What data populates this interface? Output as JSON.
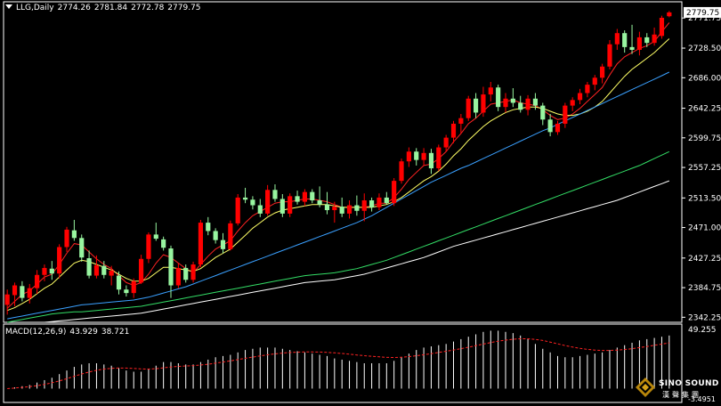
{
  "header": {
    "symbol": "LLG,Daily",
    "open": "2774.26",
    "high": "2781.84",
    "low": "2772.78",
    "close": "2779.75"
  },
  "macd": {
    "label": "MACD(12,26,9)",
    "main": "43.929",
    "signal": "38.721"
  },
  "logo": {
    "brand": "SINO SOUND",
    "sub": "漢聲集團"
  },
  "colors": {
    "up": "#ff0000",
    "down": "#98f5a0",
    "ma_fast": "#ff2222",
    "ma_mid": "#ffff66",
    "ma_slow1": "#3aa0ff",
    "ma_slow2": "#33dd66",
    "ma_slow3": "#ffffff",
    "grid": "#ffffff",
    "macd_hist": "#ffffff",
    "macd_signal": "#ff2222"
  },
  "chart_data": {
    "type": "candlestick",
    "title": "LLG,Daily",
    "ylim": [
      2335,
      2795
    ],
    "y_ticks": [
      "2771.75",
      "2728.50",
      "2686.00",
      "2642.25",
      "2599.75",
      "2557.25",
      "2513.50",
      "2471.00",
      "2427.25",
      "2384.75",
      "2342.25"
    ],
    "last_price_label": "2779.75",
    "candles": [
      {
        "o": 2360,
        "h": 2382,
        "l": 2346,
        "c": 2375
      },
      {
        "o": 2374,
        "h": 2392,
        "l": 2358,
        "c": 2388
      },
      {
        "o": 2387,
        "h": 2394,
        "l": 2365,
        "c": 2370
      },
      {
        "o": 2370,
        "h": 2390,
        "l": 2362,
        "c": 2384
      },
      {
        "o": 2384,
        "h": 2410,
        "l": 2376,
        "c": 2403
      },
      {
        "o": 2403,
        "h": 2418,
        "l": 2394,
        "c": 2413
      },
      {
        "o": 2412,
        "h": 2423,
        "l": 2396,
        "c": 2405
      },
      {
        "o": 2405,
        "h": 2447,
        "l": 2398,
        "c": 2443
      },
      {
        "o": 2443,
        "h": 2472,
        "l": 2436,
        "c": 2468
      },
      {
        "o": 2467,
        "h": 2482,
        "l": 2452,
        "c": 2456
      },
      {
        "o": 2456,
        "h": 2461,
        "l": 2422,
        "c": 2428
      },
      {
        "o": 2427,
        "h": 2438,
        "l": 2398,
        "c": 2402
      },
      {
        "o": 2402,
        "h": 2431,
        "l": 2398,
        "c": 2417
      },
      {
        "o": 2416,
        "h": 2423,
        "l": 2398,
        "c": 2403
      },
      {
        "o": 2402,
        "h": 2416,
        "l": 2388,
        "c": 2409
      },
      {
        "o": 2402,
        "h": 2408,
        "l": 2375,
        "c": 2382
      },
      {
        "o": 2382,
        "h": 2388,
        "l": 2372,
        "c": 2377
      },
      {
        "o": 2377,
        "h": 2398,
        "l": 2370,
        "c": 2394
      },
      {
        "o": 2392,
        "h": 2432,
        "l": 2390,
        "c": 2426
      },
      {
        "o": 2426,
        "h": 2464,
        "l": 2420,
        "c": 2461
      },
      {
        "o": 2461,
        "h": 2478,
        "l": 2452,
        "c": 2455
      },
      {
        "o": 2454,
        "h": 2458,
        "l": 2438,
        "c": 2442
      },
      {
        "o": 2441,
        "h": 2445,
        "l": 2370,
        "c": 2388
      },
      {
        "o": 2388,
        "h": 2420,
        "l": 2384,
        "c": 2413
      },
      {
        "o": 2413,
        "h": 2418,
        "l": 2392,
        "c": 2396
      },
      {
        "o": 2396,
        "h": 2422,
        "l": 2392,
        "c": 2418
      },
      {
        "o": 2418,
        "h": 2482,
        "l": 2414,
        "c": 2478
      },
      {
        "o": 2478,
        "h": 2486,
        "l": 2460,
        "c": 2466
      },
      {
        "o": 2466,
        "h": 2470,
        "l": 2448,
        "c": 2453
      },
      {
        "o": 2453,
        "h": 2463,
        "l": 2434,
        "c": 2440
      },
      {
        "o": 2440,
        "h": 2481,
        "l": 2438,
        "c": 2477
      },
      {
        "o": 2477,
        "h": 2519,
        "l": 2474,
        "c": 2514
      },
      {
        "o": 2514,
        "h": 2528,
        "l": 2506,
        "c": 2511
      },
      {
        "o": 2511,
        "h": 2516,
        "l": 2497,
        "c": 2503
      },
      {
        "o": 2503,
        "h": 2512,
        "l": 2486,
        "c": 2491
      },
      {
        "o": 2491,
        "h": 2532,
        "l": 2488,
        "c": 2525
      },
      {
        "o": 2525,
        "h": 2533,
        "l": 2508,
        "c": 2512
      },
      {
        "o": 2512,
        "h": 2519,
        "l": 2486,
        "c": 2491
      },
      {
        "o": 2491,
        "h": 2520,
        "l": 2486,
        "c": 2516
      },
      {
        "o": 2516,
        "h": 2524,
        "l": 2504,
        "c": 2508
      },
      {
        "o": 2508,
        "h": 2526,
        "l": 2502,
        "c": 2522
      },
      {
        "o": 2522,
        "h": 2526,
        "l": 2506,
        "c": 2510
      },
      {
        "o": 2510,
        "h": 2530,
        "l": 2500,
        "c": 2504
      },
      {
        "o": 2504,
        "h": 2522,
        "l": 2490,
        "c": 2496
      },
      {
        "o": 2496,
        "h": 2508,
        "l": 2478,
        "c": 2501
      },
      {
        "o": 2501,
        "h": 2514,
        "l": 2486,
        "c": 2491
      },
      {
        "o": 2491,
        "h": 2510,
        "l": 2484,
        "c": 2503
      },
      {
        "o": 2503,
        "h": 2517,
        "l": 2488,
        "c": 2495
      },
      {
        "o": 2495,
        "h": 2520,
        "l": 2480,
        "c": 2510
      },
      {
        "o": 2510,
        "h": 2514,
        "l": 2494,
        "c": 2500
      },
      {
        "o": 2500,
        "h": 2520,
        "l": 2496,
        "c": 2514
      },
      {
        "o": 2514,
        "h": 2522,
        "l": 2504,
        "c": 2506
      },
      {
        "o": 2506,
        "h": 2542,
        "l": 2502,
        "c": 2538
      },
      {
        "o": 2538,
        "h": 2570,
        "l": 2534,
        "c": 2566
      },
      {
        "o": 2566,
        "h": 2586,
        "l": 2558,
        "c": 2580
      },
      {
        "o": 2580,
        "h": 2585,
        "l": 2560,
        "c": 2568
      },
      {
        "o": 2568,
        "h": 2585,
        "l": 2560,
        "c": 2578
      },
      {
        "o": 2578,
        "h": 2584,
        "l": 2548,
        "c": 2556
      },
      {
        "o": 2556,
        "h": 2590,
        "l": 2552,
        "c": 2586
      },
      {
        "o": 2586,
        "h": 2604,
        "l": 2580,
        "c": 2600
      },
      {
        "o": 2600,
        "h": 2624,
        "l": 2592,
        "c": 2620
      },
      {
        "o": 2620,
        "h": 2634,
        "l": 2606,
        "c": 2628
      },
      {
        "o": 2628,
        "h": 2660,
        "l": 2624,
        "c": 2656
      },
      {
        "o": 2656,
        "h": 2664,
        "l": 2628,
        "c": 2636
      },
      {
        "o": 2636,
        "h": 2673,
        "l": 2630,
        "c": 2662
      },
      {
        "o": 2662,
        "h": 2680,
        "l": 2652,
        "c": 2672
      },
      {
        "o": 2672,
        "h": 2676,
        "l": 2638,
        "c": 2644
      },
      {
        "o": 2644,
        "h": 2664,
        "l": 2636,
        "c": 2656
      },
      {
        "o": 2656,
        "h": 2671,
        "l": 2644,
        "c": 2650
      },
      {
        "o": 2650,
        "h": 2660,
        "l": 2636,
        "c": 2640
      },
      {
        "o": 2640,
        "h": 2661,
        "l": 2632,
        "c": 2656
      },
      {
        "o": 2656,
        "h": 2664,
        "l": 2640,
        "c": 2646
      },
      {
        "o": 2646,
        "h": 2650,
        "l": 2618,
        "c": 2626
      },
      {
        "o": 2626,
        "h": 2634,
        "l": 2602,
        "c": 2608
      },
      {
        "o": 2608,
        "h": 2624,
        "l": 2604,
        "c": 2620
      },
      {
        "o": 2620,
        "h": 2650,
        "l": 2614,
        "c": 2646
      },
      {
        "o": 2646,
        "h": 2658,
        "l": 2638,
        "c": 2654
      },
      {
        "o": 2654,
        "h": 2670,
        "l": 2648,
        "c": 2664
      },
      {
        "o": 2664,
        "h": 2680,
        "l": 2658,
        "c": 2676
      },
      {
        "o": 2676,
        "h": 2690,
        "l": 2668,
        "c": 2686
      },
      {
        "o": 2686,
        "h": 2706,
        "l": 2678,
        "c": 2702
      },
      {
        "o": 2702,
        "h": 2740,
        "l": 2698,
        "c": 2734
      },
      {
        "o": 2734,
        "h": 2756,
        "l": 2726,
        "c": 2750
      },
      {
        "o": 2750,
        "h": 2754,
        "l": 2722,
        "c": 2730
      },
      {
        "o": 2730,
        "h": 2762,
        "l": 2720,
        "c": 2726
      },
      {
        "o": 2726,
        "h": 2752,
        "l": 2718,
        "c": 2744
      },
      {
        "o": 2744,
        "h": 2750,
        "l": 2730,
        "c": 2736
      },
      {
        "o": 2736,
        "h": 2758,
        "l": 2732,
        "c": 2748
      },
      {
        "o": 2746,
        "h": 2775,
        "l": 2742,
        "c": 2772
      },
      {
        "o": 2774.26,
        "h": 2781.84,
        "l": 2772.78,
        "c": 2779.75
      }
    ],
    "moving_averages": [
      {
        "name": "MA fast",
        "color": "#ff2222",
        "values": [
          2355,
          2365,
          2375,
          2380,
          2390,
          2400,
          2404,
          2418,
          2434,
          2448,
          2446,
          2436,
          2426,
          2418,
          2412,
          2402,
          2392,
          2388,
          2392,
          2404,
          2420,
          2432,
          2428,
          2420,
          2412,
          2406,
          2418,
          2430,
          2440,
          2446,
          2452,
          2466,
          2478,
          2488,
          2494,
          2500,
          2506,
          2508,
          2508,
          2510,
          2512,
          2512,
          2510,
          2508,
          2504,
          2500,
          2500,
          2500,
          2500,
          2502,
          2506,
          2506,
          2514,
          2526,
          2540,
          2550,
          2560,
          2562,
          2570,
          2580,
          2594,
          2606,
          2620,
          2628,
          2638,
          2648,
          2650,
          2652,
          2654,
          2650,
          2648,
          2646,
          2640,
          2632,
          2626,
          2628,
          2634,
          2642,
          2652,
          2662,
          2672,
          2690,
          2706,
          2716,
          2722,
          2728,
          2732,
          2738,
          2752,
          2765
        ]
      },
      {
        "name": "MA mid",
        "color": "#ffff66",
        "values": [
          2352,
          2356,
          2362,
          2368,
          2376,
          2384,
          2390,
          2400,
          2410,
          2420,
          2424,
          2422,
          2418,
          2414,
          2410,
          2404,
          2398,
          2394,
          2394,
          2398,
          2406,
          2414,
          2414,
          2412,
          2410,
          2408,
          2412,
          2420,
          2428,
          2434,
          2440,
          2450,
          2460,
          2470,
          2478,
          2486,
          2492,
          2496,
          2498,
          2500,
          2502,
          2504,
          2504,
          2504,
          2502,
          2500,
          2500,
          2500,
          2500,
          2500,
          2502,
          2504,
          2508,
          2514,
          2522,
          2530,
          2538,
          2544,
          2552,
          2562,
          2574,
          2584,
          2596,
          2606,
          2616,
          2624,
          2630,
          2636,
          2640,
          2642,
          2644,
          2644,
          2642,
          2638,
          2634,
          2632,
          2632,
          2634,
          2638,
          2644,
          2652,
          2664,
          2676,
          2688,
          2698,
          2706,
          2714,
          2722,
          2732,
          2742
        ]
      },
      {
        "name": "MA slow 1",
        "color": "#3aa0ff",
        "values": [
          2340,
          2342,
          2344,
          2346,
          2348,
          2350,
          2352,
          2354,
          2356,
          2358,
          2360,
          2361,
          2362,
          2363,
          2364,
          2365,
          2366,
          2367,
          2369,
          2371,
          2374,
          2377,
          2380,
          2383,
          2386,
          2390,
          2394,
          2398,
          2402,
          2406,
          2410,
          2414,
          2418,
          2422,
          2426,
          2430,
          2434,
          2438,
          2442,
          2446,
          2450,
          2454,
          2458,
          2462,
          2466,
          2470,
          2474,
          2478,
          2483,
          2488,
          2494,
          2500,
          2506,
          2512,
          2518,
          2524,
          2530,
          2536,
          2541,
          2546,
          2551,
          2556,
          2560,
          2565,
          2570,
          2575,
          2580,
          2585,
          2590,
          2595,
          2600,
          2605,
          2610,
          2614,
          2619,
          2624,
          2629,
          2634,
          2639,
          2644,
          2649,
          2654,
          2659,
          2664,
          2669,
          2674,
          2679,
          2684,
          2689,
          2694
        ]
      },
      {
        "name": "MA slow 2",
        "color": "#33dd66",
        "values": [
          2335,
          2337,
          2339,
          2341,
          2343,
          2345,
          2347,
          2348,
          2349,
          2350,
          2350,
          2351,
          2352,
          2353,
          2354,
          2355,
          2356,
          2357,
          2358,
          2360,
          2362,
          2364,
          2366,
          2368,
          2370,
          2372,
          2374,
          2376,
          2378,
          2380,
          2382,
          2384,
          2386,
          2388,
          2390,
          2392,
          2394,
          2396,
          2398,
          2400,
          2402,
          2403,
          2404,
          2405,
          2406,
          2408,
          2410,
          2412,
          2415,
          2418,
          2421,
          2424,
          2428,
          2432,
          2436,
          2440,
          2444,
          2448,
          2452,
          2456,
          2460,
          2464,
          2468,
          2472,
          2476,
          2480,
          2484,
          2488,
          2492,
          2496,
          2500,
          2504,
          2508,
          2512,
          2516,
          2520,
          2524,
          2528,
          2532,
          2536,
          2540,
          2544,
          2548,
          2552,
          2556,
          2560,
          2565,
          2570,
          2575,
          2580
        ]
      },
      {
        "name": "MA slow 3",
        "color": "#ffffff",
        "values": [
          null,
          null,
          null,
          null,
          null,
          2335,
          2336,
          2337,
          2338,
          2339,
          2340,
          2341,
          2342,
          2343,
          2344,
          2345,
          2346,
          2347,
          2348,
          2350,
          2352,
          2354,
          2356,
          2358,
          2360,
          2362,
          2364,
          2366,
          2368,
          2370,
          2372,
          2374,
          2376,
          2378,
          2380,
          2382,
          2384,
          2386,
          2388,
          2390,
          2392,
          2393,
          2394,
          2395,
          2396,
          2398,
          2400,
          2402,
          2404,
          2407,
          2410,
          2413,
          2416,
          2419,
          2422,
          2425,
          2428,
          2432,
          2436,
          2440,
          2444,
          2447,
          2450,
          2453,
          2456,
          2459,
          2462,
          2465,
          2468,
          2471,
          2474,
          2477,
          2480,
          2483,
          2486,
          2489,
          2492,
          2495,
          2498,
          2501,
          2504,
          2507,
          2510,
          2514,
          2518,
          2522,
          2526,
          2530,
          2534,
          2538
        ]
      }
    ],
    "macd": {
      "ylim": [
        -10,
        52
      ],
      "top_label": "49.255",
      "bottom_label": "-3.4951",
      "hist": [
        0,
        1,
        2,
        3,
        5,
        7,
        9,
        12,
        15,
        18,
        20,
        21,
        21,
        20,
        19,
        17,
        15,
        14,
        14,
        16,
        19,
        22,
        22,
        21,
        20,
        20,
        22,
        24,
        26,
        27,
        28,
        30,
        32,
        33,
        34,
        34,
        34,
        33,
        32,
        31,
        30,
        29,
        28,
        27,
        25,
        24,
        23,
        22,
        21,
        21,
        21,
        21,
        23,
        26,
        29,
        32,
        34,
        35,
        36,
        37,
        39,
        41,
        43,
        45,
        47,
        48,
        48,
        47,
        46,
        44,
        41,
        37,
        33,
        30,
        27,
        26,
        26,
        27,
        28,
        29,
        30,
        32,
        34,
        36,
        38,
        40,
        41,
        42,
        43,
        44
      ],
      "signal": [
        0,
        0.5,
        1,
        1.6,
        2.4,
        3.5,
        4.8,
        6.4,
        8.2,
        10.2,
        12.1,
        13.8,
        15.2,
        16.2,
        16.8,
        17.1,
        17,
        16.7,
        16.3,
        16.2,
        16.5,
        17.2,
        17.9,
        18.4,
        18.8,
        19,
        19.5,
        20.2,
        21.1,
        22,
        23,
        24,
        25.1,
        26.1,
        27.1,
        28,
        28.8,
        29.4,
        29.9,
        30.2,
        30.4,
        30.4,
        30.3,
        30,
        29.6,
        29.1,
        28.5,
        27.9,
        27.3,
        26.8,
        26.3,
        25.9,
        25.8,
        26,
        26.5,
        27.2,
        28.1,
        29,
        30,
        31,
        32,
        33.1,
        34.3,
        35.6,
        36.9,
        38.2,
        39.3,
        40.2,
        40.9,
        41.3,
        41.3,
        40.8,
        39.9,
        38.6,
        37.1,
        35.7,
        34.4,
        33.3,
        32.5,
        31.9,
        31.6,
        31.6,
        31.9,
        32.4,
        33.1,
        34,
        34.9,
        35.9,
        36.9,
        38
      ]
    }
  }
}
